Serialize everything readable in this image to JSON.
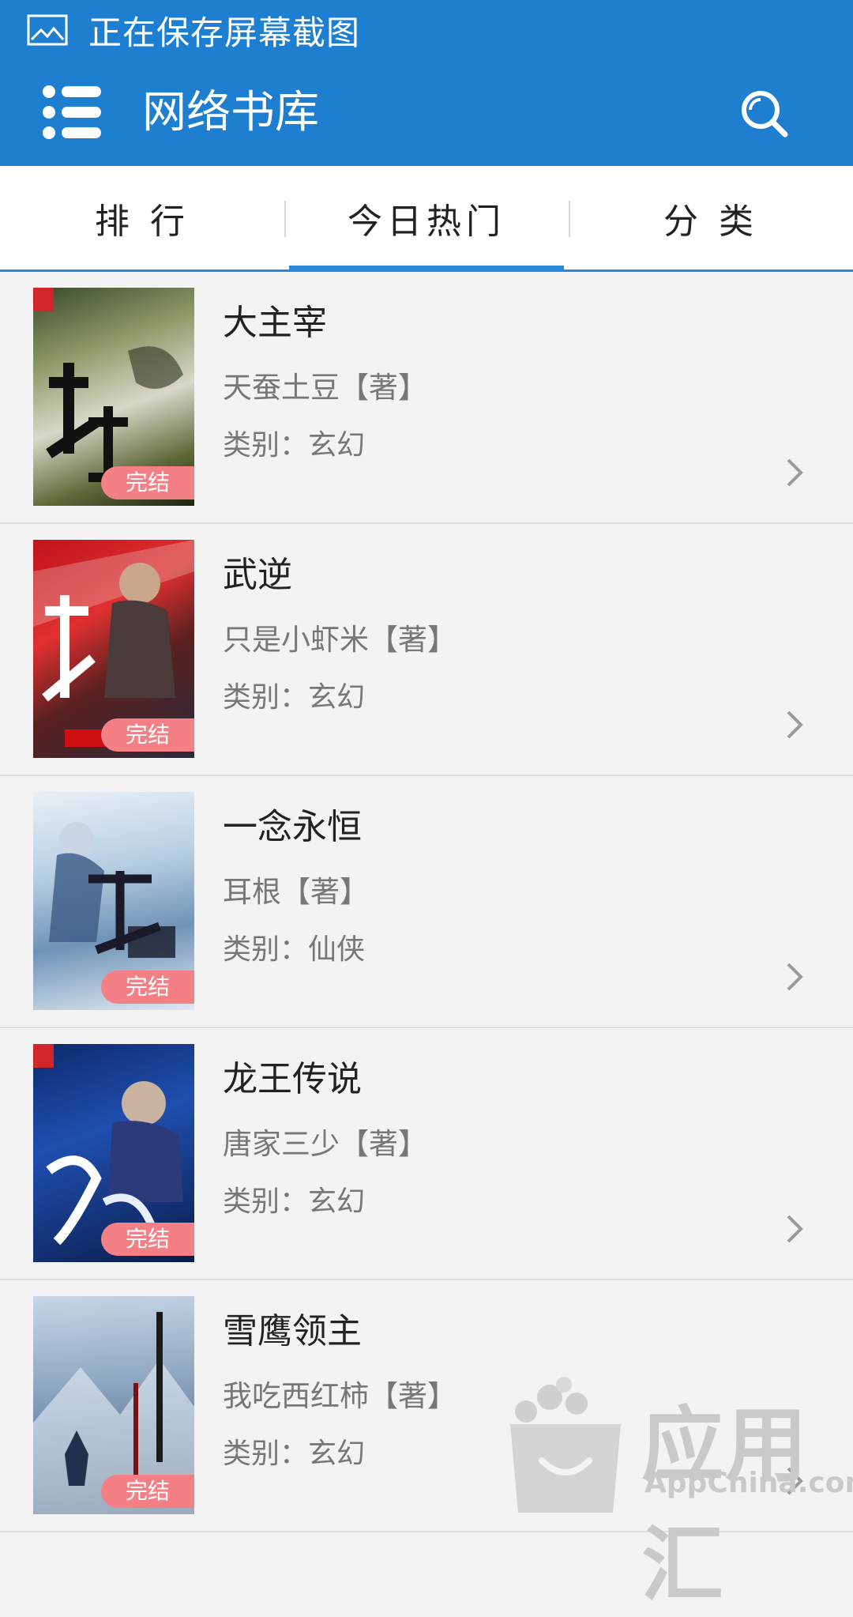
{
  "status_bar": {
    "text": "正在保存屏幕截图",
    "icon": "image-icon"
  },
  "app_bar": {
    "title": "网络书库",
    "menu_icon": "menu-icon",
    "search_icon": "search-icon"
  },
  "tabs": [
    {
      "label": "排 行",
      "active": false
    },
    {
      "label": "今日热门",
      "active": true
    },
    {
      "label": "分 类",
      "active": false
    }
  ],
  "books": [
    {
      "title": "大主宰",
      "author": "天蚕土豆【著】",
      "category": "类别：玄幻",
      "badge": "完结",
      "cover_char": "大主宰"
    },
    {
      "title": "武逆",
      "author": "只是小虾米【著】",
      "category": "类别：玄幻",
      "badge": "完结",
      "cover_char": "武逆"
    },
    {
      "title": "一念永恒",
      "author": "耳根【著】",
      "category": "类别：仙侠",
      "badge": "完结",
      "cover_char": "一念永恒"
    },
    {
      "title": "龙王传说",
      "author": "唐家三少【著】",
      "category": "类别：玄幻",
      "badge": "完结",
      "cover_char": "龙王传说"
    },
    {
      "title": "雪鹰领主",
      "author": "我吃西红柿【著】",
      "category": "类别：玄幻",
      "badge": "完结",
      "cover_char": "雪鹰领主"
    }
  ],
  "watermark": {
    "title": "应用汇",
    "subtitle": "AppChina.com"
  },
  "colors": {
    "primary": "#1e7fd0",
    "badge": "#f47f84",
    "background": "#f3f3f3"
  }
}
